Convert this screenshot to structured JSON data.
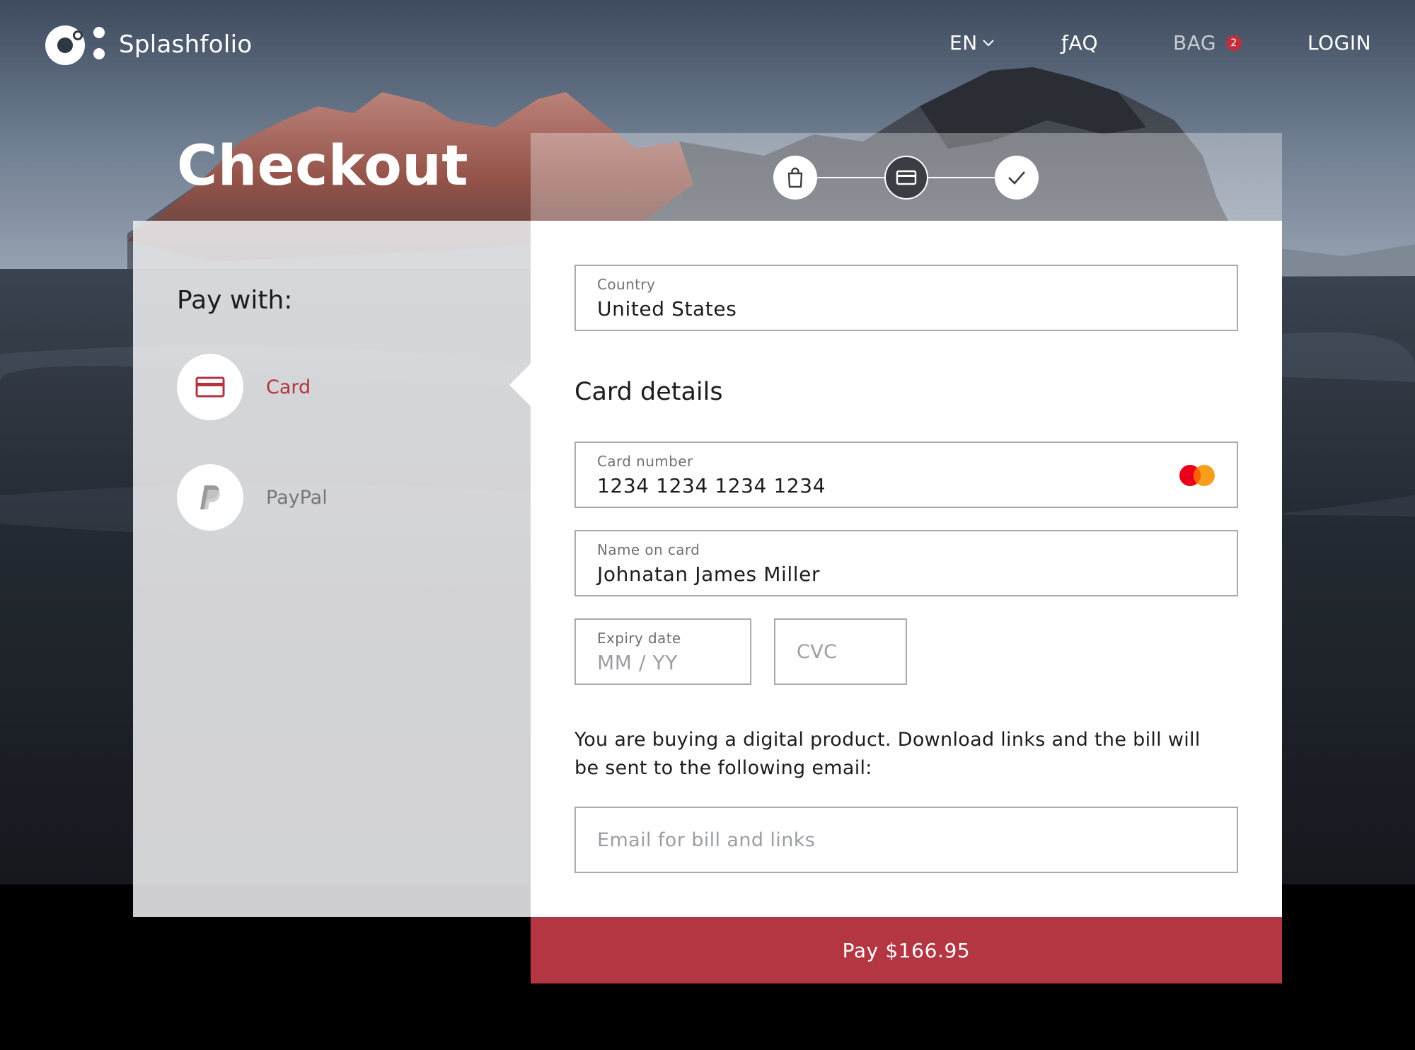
{
  "header": {
    "brand": "Splashfolio",
    "nav": {
      "language": "EN",
      "faq": "ƒAQ",
      "bag": "BAG",
      "bag_count": "2",
      "login": "LOGIN"
    }
  },
  "page": {
    "title": "Checkout"
  },
  "stepper": {
    "steps": [
      "bag-icon",
      "card-icon",
      "check-icon"
    ],
    "active_step": 2
  },
  "payment_methods": {
    "heading": "Pay with:",
    "options": [
      {
        "label": "Card",
        "icon": "card-icon",
        "selected": true
      },
      {
        "label": "PayPal",
        "icon": "paypal-icon",
        "selected": false
      }
    ]
  },
  "form": {
    "country": {
      "label": "Country",
      "value": "United States"
    },
    "section_title": "Card details",
    "card_number": {
      "label": "Card number",
      "value": "1234 1234 1234 1234",
      "brand_icon": "mastercard-icon"
    },
    "name_on_card": {
      "label": "Name on card",
      "value": "Johnatan James Miller"
    },
    "expiry": {
      "label": "Expiry date",
      "placeholder": "MM / YY"
    },
    "cvc": {
      "placeholder": "CVC"
    },
    "notice": "You are buying a digital product. Download links and the bill will be sent to the following email:",
    "email": {
      "placeholder": "Email for bill and links"
    }
  },
  "pay_button": {
    "label": "Pay $166.95"
  },
  "colors": {
    "accent": "#b43643",
    "badge": "#c0303c"
  }
}
